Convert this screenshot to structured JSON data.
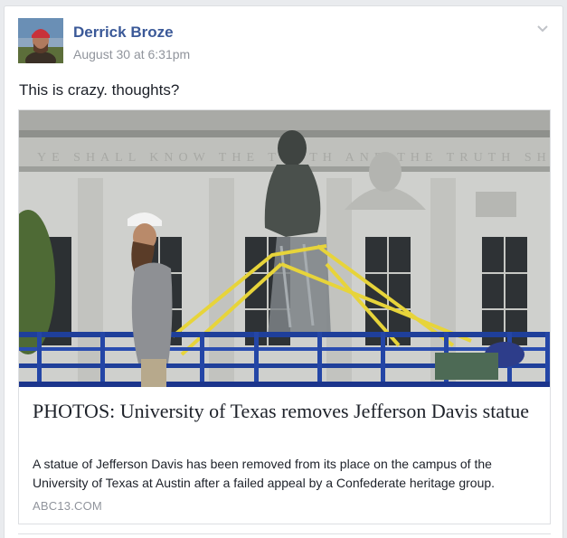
{
  "post": {
    "author": "Derrick Broze",
    "timestamp": "August 30 at 6:31pm",
    "status_text": "This is crazy. thoughts?",
    "options_icon": "chevron-down-icon"
  },
  "link_card": {
    "headline": "PHOTOS: University of Texas removes Jefferson Davis statue",
    "description": "A statue of Jefferson Davis has been removed from its place on the campus of the University of Texas at Austin after a failed appeal by a Confederate heritage group.",
    "source": "ABC13.COM"
  },
  "colors": {
    "author_link": "#3b5998",
    "meta_gray": "#90949c",
    "text": "#1d2129",
    "border": "#dddfe2",
    "background": "#e9ebee"
  }
}
